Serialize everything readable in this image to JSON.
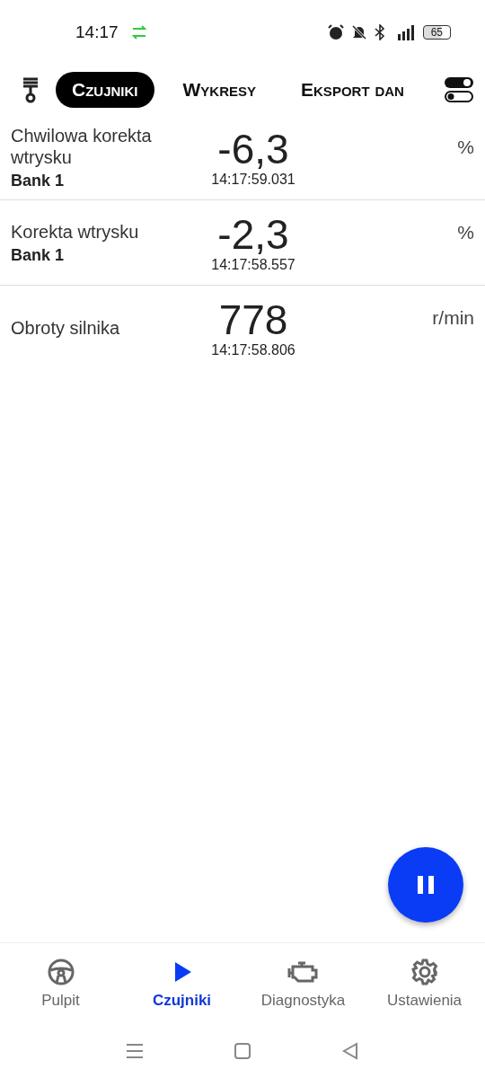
{
  "status_bar": {
    "time": "14:17",
    "battery": "65"
  },
  "tabs": [
    {
      "label": "Czujniki",
      "selected": true
    },
    {
      "label": "Wykresy",
      "selected": false
    },
    {
      "label": "Eksport dan",
      "selected": false
    }
  ],
  "sensors": [
    {
      "name": "Chwilowa korekta wtrysku",
      "sub": "Bank 1",
      "value": "-6,3",
      "time": "14:17:59.031",
      "unit": "%"
    },
    {
      "name": "Korekta wtrysku",
      "sub": "Bank 1",
      "value": "-2,3",
      "time": "14:17:58.557",
      "unit": "%"
    },
    {
      "name": "Obroty silnika",
      "value": "778",
      "time": "14:17:58.806",
      "unit": "r/min"
    }
  ],
  "bottom_nav": [
    {
      "label": "Pulpit",
      "kind": "wheel",
      "selected": false
    },
    {
      "label": "Czujniki",
      "kind": "play",
      "selected": true
    },
    {
      "label": "Diagnostyka",
      "kind": "engine",
      "selected": false
    },
    {
      "label": "Ustawienia",
      "kind": "gear",
      "selected": false
    }
  ]
}
